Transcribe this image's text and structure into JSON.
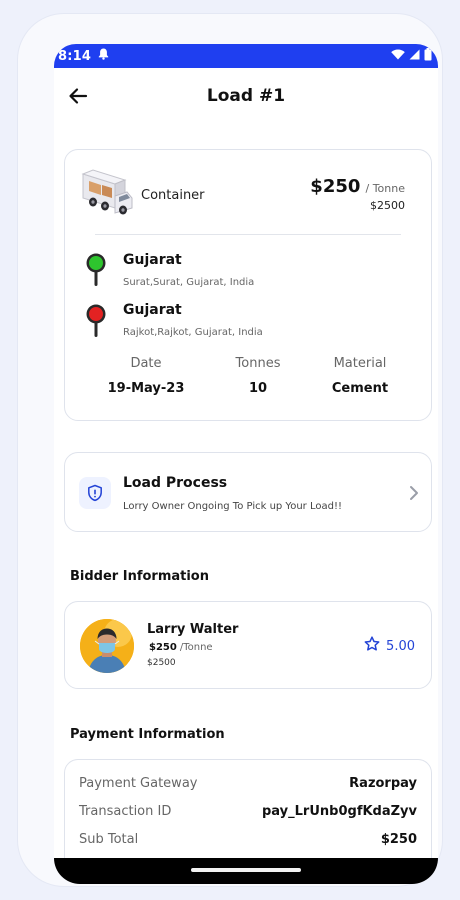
{
  "status_bar": {
    "time": "8:14"
  },
  "header": {
    "title": "Load #1"
  },
  "load": {
    "vehicle": "Container",
    "price": "$250",
    "price_unit": "/ Tonne",
    "price_total": "$2500",
    "pickup": {
      "city": "Gujarat",
      "address": "Surat,Surat, Gujarat, India",
      "pin_color": "#2ec52e"
    },
    "drop": {
      "city": "Gujarat",
      "address": "Rajkot,Rajkot, Gujarat, India",
      "pin_color": "#e32222"
    },
    "stats": [
      {
        "label": "Date",
        "value": "19-May-23"
      },
      {
        "label": "Tonnes",
        "value": "10"
      },
      {
        "label": "Material",
        "value": "Cement"
      }
    ]
  },
  "process": {
    "title": "Load Process",
    "subtitle": "Lorry Owner Ongoing To Pick up Your Load!!"
  },
  "bidder": {
    "section_title": "Bidder Information",
    "name": "Larry Walter",
    "price": "$250",
    "price_unit": "/Tonne",
    "total": "$2500",
    "rating": "5.00"
  },
  "payment": {
    "section_title": "Payment Information",
    "rows": [
      {
        "label": "Payment Gateway",
        "value": "Razorpay"
      },
      {
        "label": "Transaction ID",
        "value": "pay_LrUnb0gfKdaZyv"
      },
      {
        "label": "Sub Total",
        "value": "$250"
      }
    ]
  },
  "colors": {
    "accent": "#2444d6",
    "status_bar": "#1f3ff0"
  }
}
